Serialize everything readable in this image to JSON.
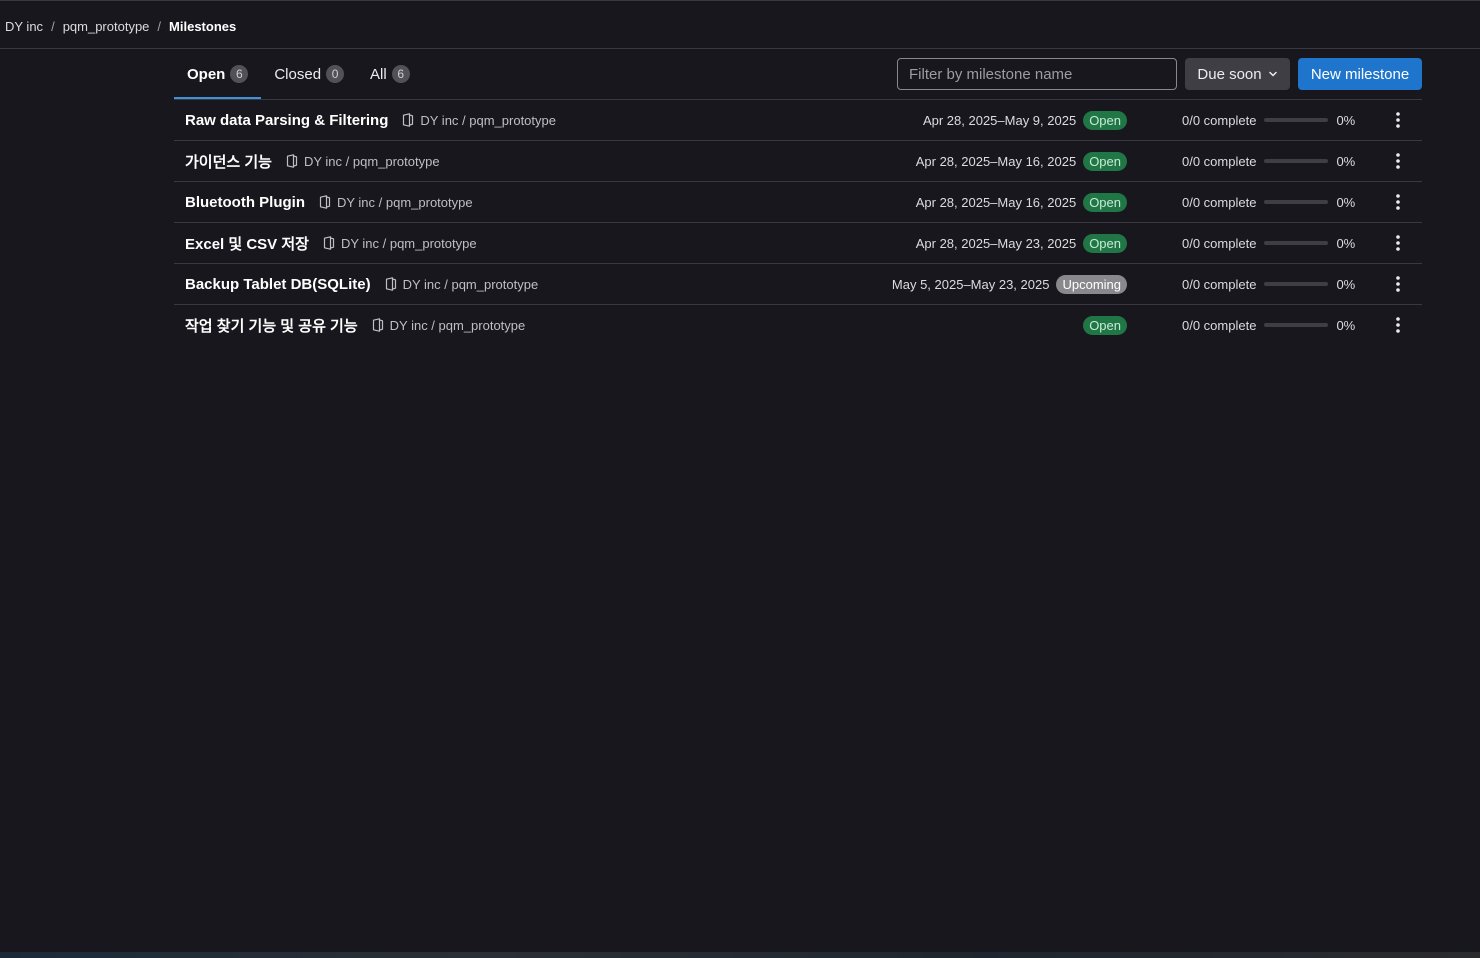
{
  "breadcrumb": {
    "items": [
      "DY inc",
      "pqm_prototype"
    ],
    "current": "Milestones",
    "separator": "/"
  },
  "tabs": [
    {
      "label": "Open",
      "count": "6",
      "active": true
    },
    {
      "label": "Closed",
      "count": "0",
      "active": false
    },
    {
      "label": "All",
      "count": "6",
      "active": false
    }
  ],
  "filter": {
    "placeholder": "Filter by milestone name",
    "value": ""
  },
  "sort": {
    "label": "Due soon",
    "icon": "chevron-down-icon"
  },
  "new_button": {
    "label": "New milestone"
  },
  "colors": {
    "accent": "#1f75cb",
    "open_badge": "#217645",
    "upcoming_badge": "#89888d"
  },
  "milestones": [
    {
      "title": "Raw data Parsing & Filtering",
      "project": "DY inc / pqm_prototype",
      "dates": "Apr 28, 2025–May 9, 2025",
      "status": "Open",
      "complete": "0/0 complete",
      "progress": 0,
      "percent": "0%"
    },
    {
      "title": "가이던스 기능",
      "project": "DY inc / pqm_prototype",
      "dates": "Apr 28, 2025–May 16, 2025",
      "status": "Open",
      "complete": "0/0 complete",
      "progress": 0,
      "percent": "0%"
    },
    {
      "title": "Bluetooth Plugin",
      "project": "DY inc / pqm_prototype",
      "dates": "Apr 28, 2025–May 16, 2025",
      "status": "Open",
      "complete": "0/0 complete",
      "progress": 0,
      "percent": "0%"
    },
    {
      "title": "Excel 및 CSV 저장",
      "project": "DY inc / pqm_prototype",
      "dates": "Apr 28, 2025–May 23, 2025",
      "status": "Open",
      "complete": "0/0 complete",
      "progress": 0,
      "percent": "0%"
    },
    {
      "title": "Backup Tablet DB(SQLite)",
      "project": "DY inc / pqm_prototype",
      "dates": "May 5, 2025–May 23, 2025",
      "status": "Upcoming",
      "complete": "0/0 complete",
      "progress": 0,
      "percent": "0%"
    },
    {
      "title": "작업 찾기 기능 및 공유 기능",
      "project": "DY inc / pqm_prototype",
      "dates": "",
      "status": "Open",
      "complete": "0/0 complete",
      "progress": 0,
      "percent": "0%"
    }
  ]
}
